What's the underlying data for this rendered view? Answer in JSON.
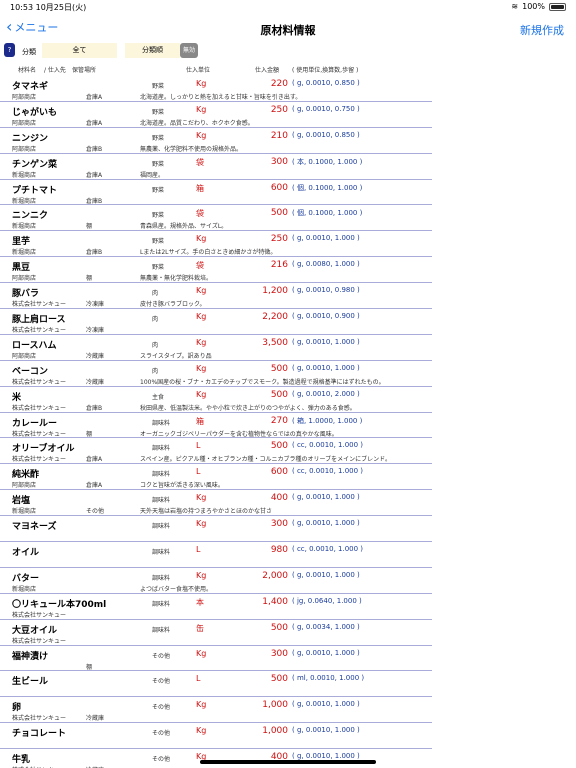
{
  "status": {
    "time": "10:53",
    "date": "10月25日(火)",
    "battery": "100%"
  },
  "nav": {
    "back_label": "メニュー",
    "title": "原材料情報",
    "new_label": "新規作成"
  },
  "filter": {
    "help": "?",
    "label1": "分類",
    "value1": "全て",
    "value2": "分類順",
    "toggle": "無効"
  },
  "header": {
    "c1": "材料名",
    "c2": "/ 仕入先",
    "c3": "保管場所",
    "c4": "仕入単位",
    "c5": "仕入金額",
    "c6": "( 使用単位,換算数,歩留 )"
  },
  "rows": [
    {
      "name": "タマネギ",
      "supplier": "阿部商店",
      "storage": "倉庫A",
      "cat": "野菜",
      "unit": "Kg",
      "price": "220",
      "detail": "( g, 0.0010, 0.850 )",
      "note": "北海道産。しっかりと熱を加えると甘味・旨味を引き出す。"
    },
    {
      "name": "じゃがいも",
      "supplier": "阿部商店",
      "storage": "倉庫A",
      "cat": "野菜",
      "unit": "Kg",
      "price": "250",
      "detail": "( g, 0.0010, 0.750 )",
      "note": "北海道産。品質こだわり、ホクホク食感。"
    },
    {
      "name": "ニンジン",
      "supplier": "阿部商店",
      "storage": "倉庫B",
      "cat": "野菜",
      "unit": "Kg",
      "price": "210",
      "detail": "( g, 0.0010, 0.850 )",
      "note": "無農薬、化学肥料不使用の規格外品。"
    },
    {
      "name": "チンゲン菜",
      "supplier": "新堀商店",
      "storage": "倉庫A",
      "cat": "野菜",
      "unit": "袋",
      "price": "300",
      "detail": "( 本, 0.1000, 1.000 )",
      "note": "福岡産。"
    },
    {
      "name": "プチトマト",
      "supplier": "新堀商店",
      "storage": "倉庫B",
      "cat": "野菜",
      "unit": "箱",
      "price": "600",
      "detail": "( 個, 0.1000, 1.000 )",
      "note": ""
    },
    {
      "name": "ニンニク",
      "supplier": "新堀商店",
      "storage": "棚",
      "cat": "野菜",
      "unit": "袋",
      "price": "500",
      "detail": "( 個, 0.1000, 1.000 )",
      "note": "青森県産。規格外品、サイズL。"
    },
    {
      "name": "里芋",
      "supplier": "新堀商店",
      "storage": "倉庫B",
      "cat": "野菜",
      "unit": "Kg",
      "price": "250",
      "detail": "( g, 0.0010, 1.000 )",
      "note": "Lまたは2Lサイズ。手の白さときめ細かさが特徴。"
    },
    {
      "name": "黒豆",
      "supplier": "阿部商店",
      "storage": "棚",
      "cat": "野菜",
      "unit": "袋",
      "price": "216",
      "detail": "( g, 0.0080, 1.000 )",
      "note": "無農薬・無化学肥料栽培。"
    },
    {
      "name": "豚バラ",
      "supplier": "株式会社サンキュー",
      "storage": "冷凍庫",
      "cat": "肉",
      "unit": "Kg",
      "price": "1,200",
      "detail": "( g, 0.0010, 0.980 )",
      "note": "皮付き豚バラブロック。"
    },
    {
      "name": "豚上肩ロース",
      "supplier": "株式会社サンキュー",
      "storage": "冷凍庫",
      "cat": "肉",
      "unit": "Kg",
      "price": "2,200",
      "detail": "( g, 0.0010, 0.900 )",
      "note": ""
    },
    {
      "name": "ロースハム",
      "supplier": "阿部商店",
      "storage": "冷蔵庫",
      "cat": "肉",
      "unit": "Kg",
      "price": "3,500",
      "detail": "( g, 0.0010, 1.000 )",
      "note": "スライスタイプ。訳あり品"
    },
    {
      "name": "ベーコン",
      "supplier": "株式会社サンキュー",
      "storage": "冷蔵庫",
      "cat": "肉",
      "unit": "Kg",
      "price": "500",
      "detail": "( g, 0.0010, 1.000 )",
      "note": "100%国産の桜・ブナ・カエデのチップでスモーク。製造過程で規格基準にはずれたもの。"
    },
    {
      "name": "米",
      "supplier": "株式会社サンキュー",
      "storage": "倉庫B",
      "cat": "主食",
      "unit": "Kg",
      "price": "500",
      "detail": "( g, 0.0010, 2.000 )",
      "note": "秋田県産、低温製法米。やや小粒で炊き上がりのつやがよく、弾力のある食感。"
    },
    {
      "name": "カレールー",
      "supplier": "株式会社サンキュー",
      "storage": "棚",
      "cat": "調味料",
      "unit": "箱",
      "price": "270",
      "detail": "( 箱, 1.0000, 1.000 )",
      "note": "オーガニックゴジベリーパウダーを含む植物性ならではの真やかな風味。"
    },
    {
      "name": "オリーブオイル",
      "supplier": "株式会社サンキュー",
      "storage": "倉庫A",
      "cat": "調味料",
      "unit": "L",
      "price": "500",
      "detail": "( cc, 0.0010, 1.000 )",
      "note": "スペイン産。ピクアル種・オヒブランカ種・コルニカブラ種のオリーブをメインにブレンド。"
    },
    {
      "name": "純米酢",
      "supplier": "阿部商店",
      "storage": "倉庫A",
      "cat": "調味料",
      "unit": "L",
      "price": "600",
      "detail": "( cc, 0.0010, 1.000 )",
      "note": "コクと旨味が活きる深い風味。"
    },
    {
      "name": "岩塩",
      "supplier": "新堀商店",
      "storage": "その他",
      "cat": "調味料",
      "unit": "Kg",
      "price": "400",
      "detail": "( g, 0.0010, 1.000 )",
      "note": "天外天塩は岩塩の持つまろやかさとほのかな甘さ"
    },
    {
      "name": "マヨネーズ",
      "supplier": "",
      "storage": "",
      "cat": "調味料",
      "unit": "Kg",
      "price": "300",
      "detail": "( g, 0.0010, 1.000 )",
      "note": ""
    },
    {
      "name": "オイル",
      "supplier": "",
      "storage": "",
      "cat": "調味料",
      "unit": "L",
      "price": "980",
      "detail": "( cc, 0.0010, 1.000 )",
      "note": ""
    },
    {
      "name": "バター",
      "supplier": "新堀商店",
      "storage": "",
      "cat": "調味料",
      "unit": "Kg",
      "price": "2,000",
      "detail": "( g, 0.0010, 1.000 )",
      "note": "よつばバター食塩不使用。"
    },
    {
      "name": "〇リキュール本700ml",
      "supplier": "株式会社サンキュー",
      "storage": "",
      "cat": "調味料",
      "unit": "本",
      "price": "1,400",
      "detail": "( jg, 0.0640, 1.000 )",
      "note": ""
    },
    {
      "name": "大豆オイル",
      "supplier": "株式会社サンキュー",
      "storage": "",
      "cat": "調味料",
      "unit": "缶",
      "price": "500",
      "detail": "( g, 0.0034, 1.000 )",
      "note": ""
    },
    {
      "name": "福神漬け",
      "supplier": "",
      "storage": "棚",
      "cat": "その他",
      "unit": "Kg",
      "price": "300",
      "detail": "( g, 0.0010, 1.000 )",
      "note": ""
    },
    {
      "name": "生ビール",
      "supplier": "",
      "storage": "",
      "cat": "その他",
      "unit": "L",
      "price": "500",
      "detail": "( ml, 0.0010, 1.000 )",
      "note": ""
    },
    {
      "name": "卵",
      "supplier": "株式会社サンキュー",
      "storage": "冷蔵庫",
      "cat": "その他",
      "unit": "Kg",
      "price": "1,000",
      "detail": "( g, 0.0010, 1.000 )",
      "note": ""
    },
    {
      "name": "チョコレート",
      "supplier": "",
      "storage": "",
      "cat": "その他",
      "unit": "Kg",
      "price": "1,000",
      "detail": "( g, 0.0010, 1.000 )",
      "note": ""
    },
    {
      "name": "牛乳",
      "supplier": "株式会社サンキュー",
      "storage": "冷蔵庫",
      "cat": "その他",
      "unit": "Kg",
      "price": "400",
      "detail": "( g, 0.0010, 1.000 )",
      "note": ""
    }
  ]
}
